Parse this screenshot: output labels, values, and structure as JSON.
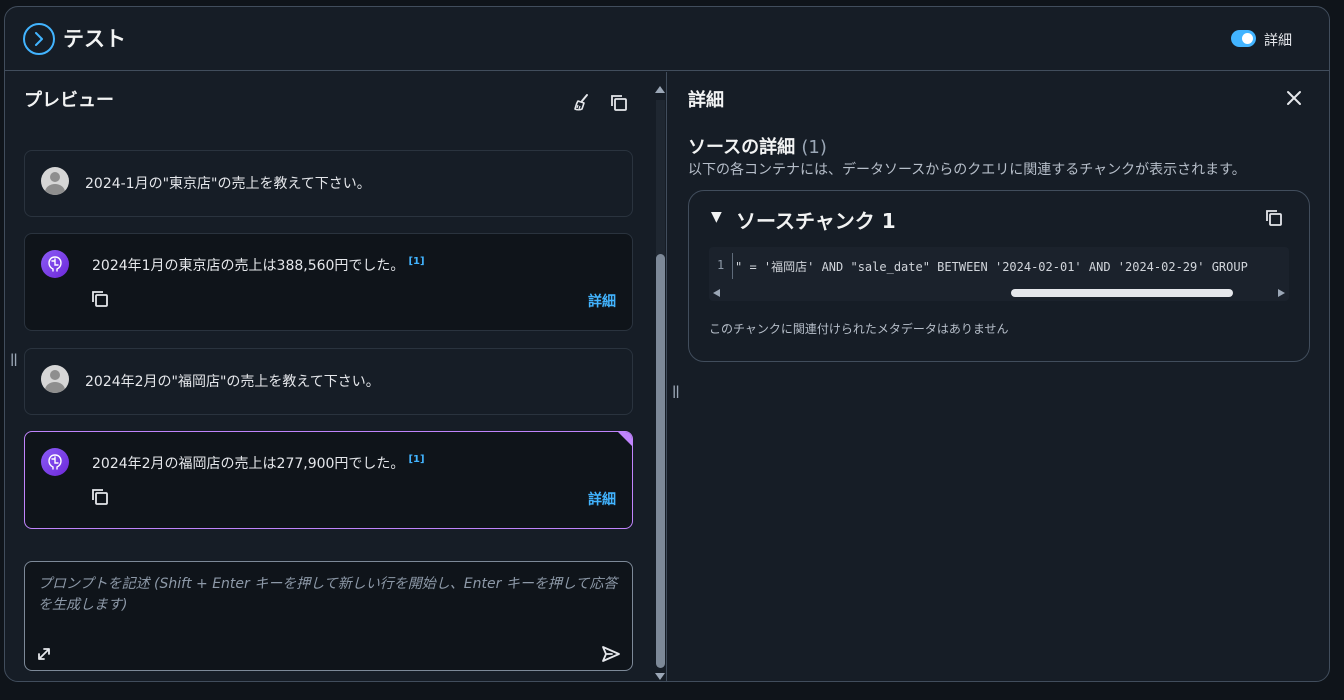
{
  "header": {
    "title": "テスト",
    "toggle_label": "詳細",
    "toggle_on": true,
    "accent_color": "#42b4ff"
  },
  "preview": {
    "title": "プレビュー",
    "messages": [
      {
        "role": "user",
        "text": "2024-1月の\"東京店\"の売上を教えて下さい。"
      },
      {
        "role": "assistant",
        "text": "2024年1月の東京店の売上は388,560円でした。",
        "citation": "[1]",
        "detail_label": "詳細"
      },
      {
        "role": "user",
        "text": "2024年2月の\"福岡店\"の売上を教えて下さい。"
      },
      {
        "role": "assistant",
        "text": "2024年2月の福岡店の売上は277,900円でした。",
        "citation": "[1]",
        "detail_label": "詳細",
        "selected": true
      }
    ],
    "prompt_placeholder": "プロンプトを記述 (Shift + Enter キーを押して新しい行を開始し、Enter キーを押して応答を生成します)"
  },
  "details": {
    "title": "詳細",
    "sources_heading": "ソースの詳細",
    "sources_count": "(1)",
    "sources_description": "以下の各コンテナには、データソースからのクエリに関連するチャンクが表示されます。",
    "chunk": {
      "title": "ソースチャンク 1",
      "line_number": "1",
      "code": "\" = '福岡店' AND \"sale_date\" BETWEEN '2024-02-01' AND '2024-02-29' GROUP",
      "metadata_note": "このチャンクに関連付けられたメタデータはありません"
    }
  },
  "colors": {
    "selected_border": "#c084fc",
    "link": "#42b4ff"
  }
}
